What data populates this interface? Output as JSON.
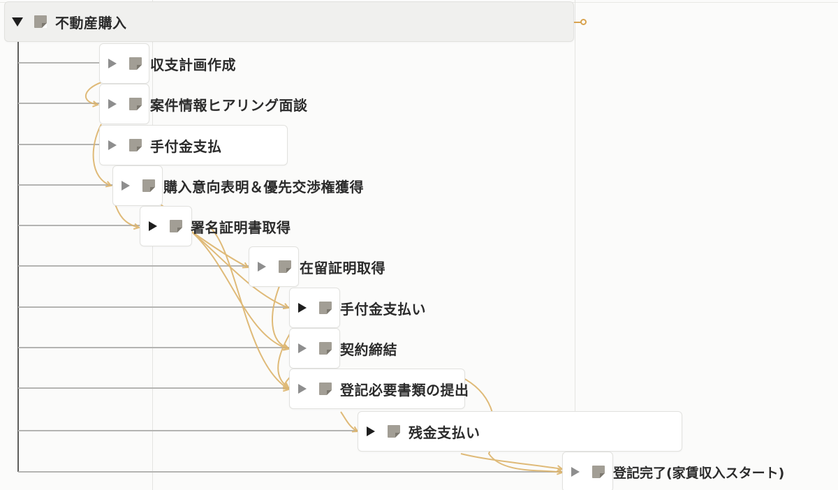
{
  "colors": {
    "background": "#fbfbfa",
    "node_bg": "#ffffff",
    "root_bg": "#f0f0ee",
    "tree_line": "#b4b4b2",
    "dependency_arrow": "#dcb36a",
    "page_icon": "#a29e95"
  },
  "root": {
    "title": "不動産購入",
    "toggle_state": "expanded",
    "icon": "page-icon"
  },
  "tasks": [
    {
      "title": "収支計画作成",
      "toggle_style": "light",
      "icon": "page-icon"
    },
    {
      "title": "案件情報ヒアリング面談",
      "toggle_style": "light",
      "icon": "page-icon"
    },
    {
      "title": "手付金支払",
      "toggle_style": "light",
      "icon": "page-icon"
    },
    {
      "title": "購入意向表明＆優先交渉権獲得",
      "toggle_style": "light",
      "icon": "page-icon"
    },
    {
      "title": "署名証明書取得",
      "toggle_style": "dark",
      "icon": "page-icon"
    },
    {
      "title": "在留証明取得",
      "toggle_style": "light",
      "icon": "page-icon"
    },
    {
      "title": "手付金支払い",
      "toggle_style": "dark",
      "icon": "page-icon"
    },
    {
      "title": "契約締結",
      "toggle_style": "light",
      "icon": "page-icon"
    },
    {
      "title": "登記必要書類の提出",
      "toggle_style": "light",
      "icon": "page-icon"
    },
    {
      "title": "残金支払い",
      "toggle_style": "dark",
      "icon": "page-icon"
    },
    {
      "title": "登記完了(家賃収入スタート)",
      "toggle_style": "light",
      "icon": "page-icon"
    }
  ]
}
